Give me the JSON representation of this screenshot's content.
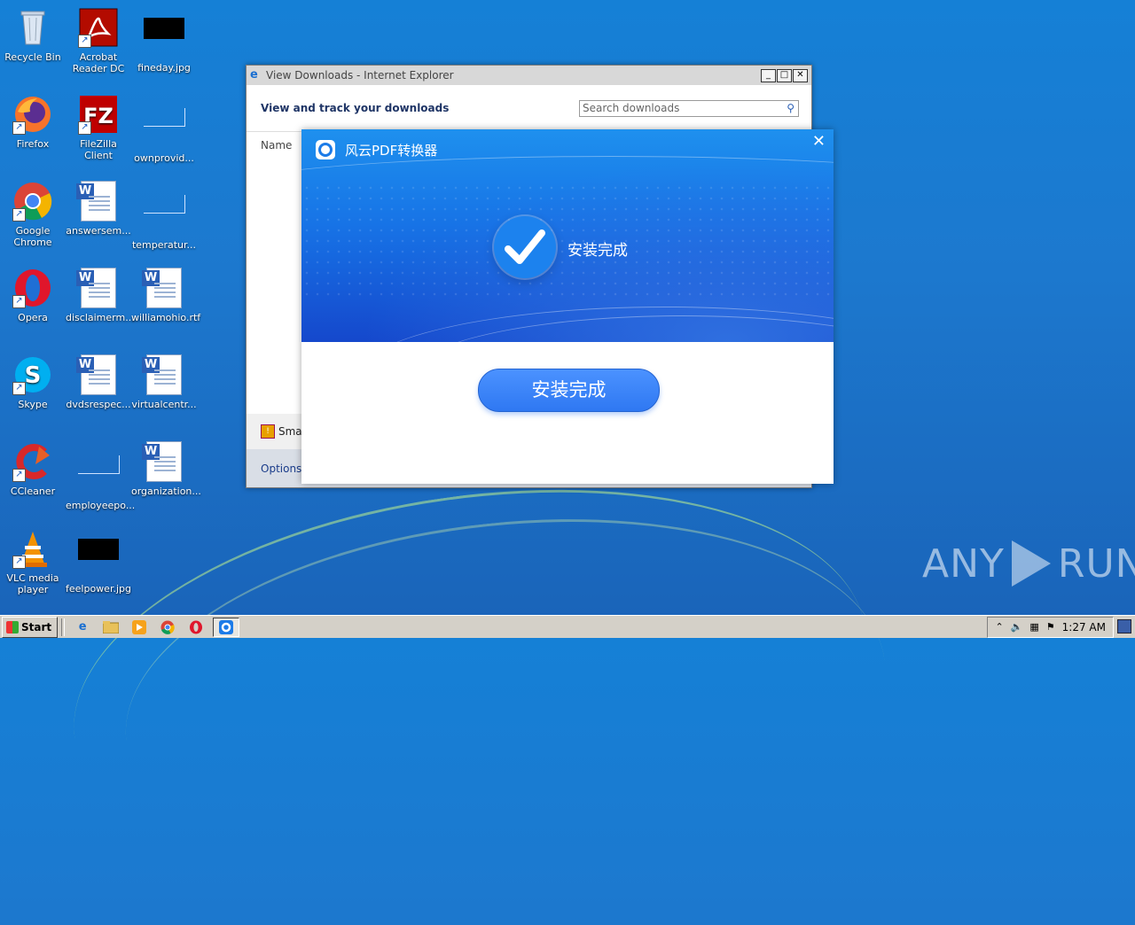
{
  "desktop": {
    "icons": [
      {
        "label": "Recycle Bin"
      },
      {
        "label": "Acrobat Reader DC"
      },
      {
        "label": "fineday.jpg"
      },
      {
        "label": "Firefox"
      },
      {
        "label": "FileZilla Client"
      },
      {
        "label": "ownprovid..."
      },
      {
        "label": "Google Chrome"
      },
      {
        "label": "answersem..."
      },
      {
        "label": "temperatur..."
      },
      {
        "label": "Opera"
      },
      {
        "label": "disclaimerm..."
      },
      {
        "label": "williamohio.rtf"
      },
      {
        "label": "Skype"
      },
      {
        "label": "dvdsrespec..."
      },
      {
        "label": "virtualcentr..."
      },
      {
        "label": "CCleaner"
      },
      {
        "label": "employeepo..."
      },
      {
        "label": "organization..."
      },
      {
        "label": "VLC media player"
      },
      {
        "label": "feelpower.jpg"
      }
    ]
  },
  "ie_window": {
    "title": "View Downloads - Internet Explorer",
    "heading": "View and track your downloads",
    "search_placeholder": "Search downloads",
    "column_name": "Name",
    "smartscreen": "Smar",
    "options": "Options"
  },
  "installer": {
    "app_name": "风云PDF转换器",
    "status_text": "安装完成",
    "button_label": "安装完成",
    "close_glyph": "✕"
  },
  "taskbar": {
    "start_label": "Start",
    "clock": "1:27 AM"
  },
  "watermark": {
    "left": "ANY",
    "right": "RUN"
  }
}
